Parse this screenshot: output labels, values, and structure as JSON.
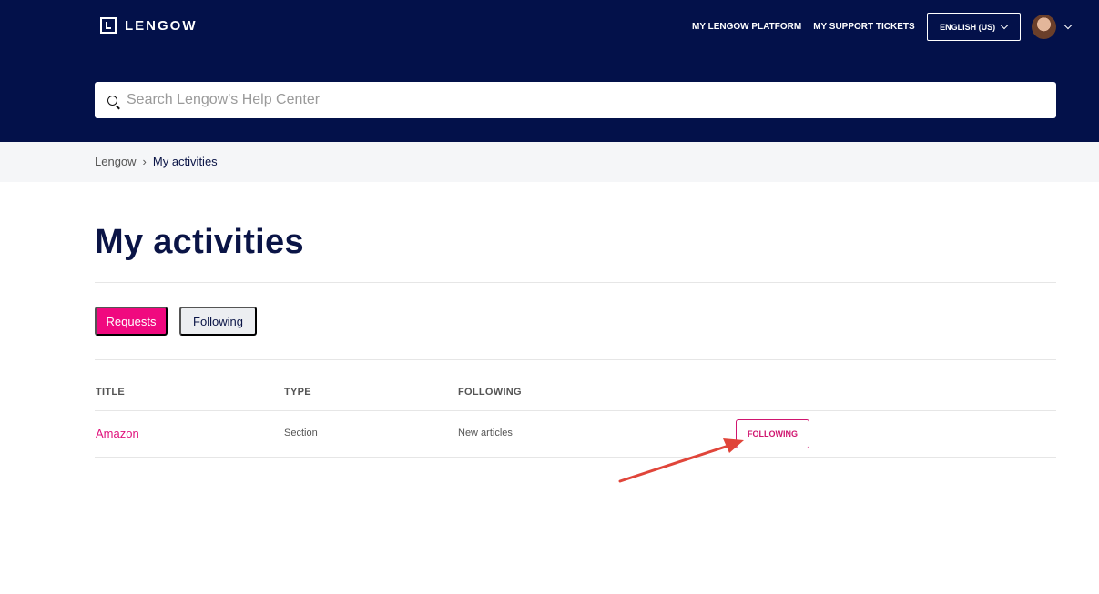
{
  "header": {
    "logo_text": "LENGOW",
    "nav": {
      "platform": "MY LENGOW PLATFORM",
      "tickets": "MY SUPPORT TICKETS",
      "language": "ENGLISH (US)"
    },
    "search_placeholder": "Search Lengow's Help Center"
  },
  "breadcrumb": {
    "root": "Lengow",
    "separator": "›",
    "current": "My activities"
  },
  "page": {
    "title": "My activities",
    "tabs": {
      "requests": "Requests",
      "following": "Following"
    }
  },
  "table": {
    "headers": {
      "title": "TITLE",
      "type": "TYPE",
      "following": "FOLLOWING"
    },
    "rows": [
      {
        "title": "Amazon",
        "type": "Section",
        "following": "New articles",
        "action": "FOLLOWING"
      }
    ]
  },
  "colors": {
    "header_bg": "#03114a",
    "accent": "#f0097f",
    "annotation_arrow": "#e0453a"
  }
}
